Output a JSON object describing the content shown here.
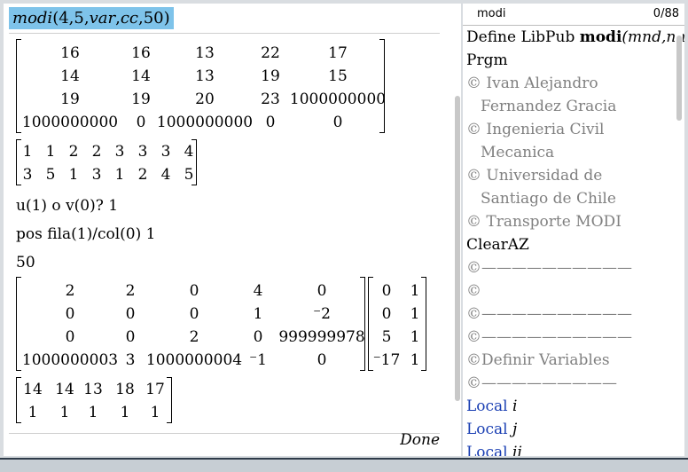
{
  "calculator": {
    "command": {
      "fn": "modi",
      "args": "4,5,",
      "var": "var",
      "comma": ",",
      "cc": "cc",
      "tail": ",50)"
    },
    "matrix1": [
      [
        "16",
        "16",
        "13",
        "22",
        "17"
      ],
      [
        "14",
        "14",
        "13",
        "19",
        "15"
      ],
      [
        "19",
        "19",
        "20",
        "23",
        "1000000000"
      ],
      [
        "1000000000",
        "0",
        "1000000000",
        "0",
        "0"
      ]
    ],
    "matrix2": [
      [
        "1",
        "1",
        "2",
        "2",
        "3",
        "3",
        "3",
        "4"
      ],
      [
        "3",
        "5",
        "1",
        "3",
        "1",
        "2",
        "4",
        "5"
      ]
    ],
    "line_u": "u(1) o v(0)? 1",
    "line_pos": "pos fila(1)/col(0) 1",
    "line_50": "50",
    "matrix3": [
      [
        "2",
        "2",
        "0",
        "4",
        "0"
      ],
      [
        "0",
        "0",
        "0",
        "1",
        "⁻2"
      ],
      [
        "0",
        "0",
        "2",
        "0",
        "999999978"
      ],
      [
        "1000000003",
        "3",
        "1000000004",
        "⁻1",
        "0"
      ]
    ],
    "matrix4": [
      [
        "0",
        "1"
      ],
      [
        "0",
        "1"
      ],
      [
        "5",
        "1"
      ],
      [
        "⁻17",
        "1"
      ]
    ],
    "matrix5": [
      [
        "14",
        "14",
        "13",
        "18",
        "17"
      ],
      [
        "1",
        "1",
        "1",
        "1",
        "1"
      ]
    ],
    "done": "Done"
  },
  "editor": {
    "name": "modi",
    "count": "0/88",
    "lines": [
      {
        "text": "Define LibPub ",
        "bold": "modi",
        "tail": "(mnd,nn",
        "style": "k"
      },
      {
        "text": "Prgm",
        "style": "k"
      },
      {
        "text": "© Ivan Alejandro",
        "style": "c"
      },
      {
        "text": "Fernandez Gracia",
        "style": "c",
        "indent": true
      },
      {
        "text": "© Ingenieria Civil",
        "style": "c"
      },
      {
        "text": "Mecanica",
        "style": "c",
        "indent": true
      },
      {
        "text": "© Universidad de",
        "style": "c"
      },
      {
        "text": "Santiago de Chile",
        "style": "c",
        "indent": true
      },
      {
        "text": "© Transporte MODI",
        "style": "c"
      },
      {
        "text": "ClearAZ",
        "style": "k"
      },
      {
        "text": "©——————————",
        "style": "c"
      },
      {
        "text": "©",
        "style": "c"
      },
      {
        "text": "©——————————",
        "style": "c"
      },
      {
        "text": "©——————————",
        "style": "c"
      },
      {
        "text": "©Definir Variables",
        "style": "c"
      },
      {
        "text": "©—————————",
        "style": "c"
      },
      {
        "text": "Local ",
        "var": "i",
        "style": "b"
      },
      {
        "text": "Local ",
        "var": "j",
        "style": "b"
      },
      {
        "text": "Local ",
        "var": "ii",
        "style": "b"
      }
    ]
  }
}
